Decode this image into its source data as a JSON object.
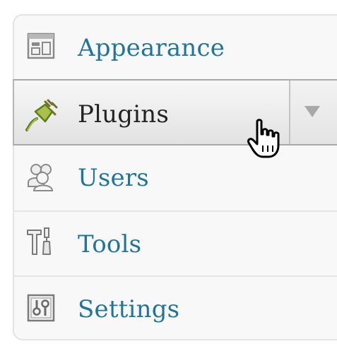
{
  "sidebar": {
    "items": [
      {
        "label": "Appearance",
        "icon": "appearance-icon"
      },
      {
        "label": "Plugins",
        "icon": "plug-icon",
        "current": true
      },
      {
        "label": "Users",
        "icon": "users-icon"
      },
      {
        "label": "Tools",
        "icon": "tools-icon"
      },
      {
        "label": "Settings",
        "icon": "settings-icon"
      }
    ]
  },
  "colors": {
    "link": "#21759b",
    "current_text": "#222222",
    "plug_green": "#8aa83a"
  }
}
